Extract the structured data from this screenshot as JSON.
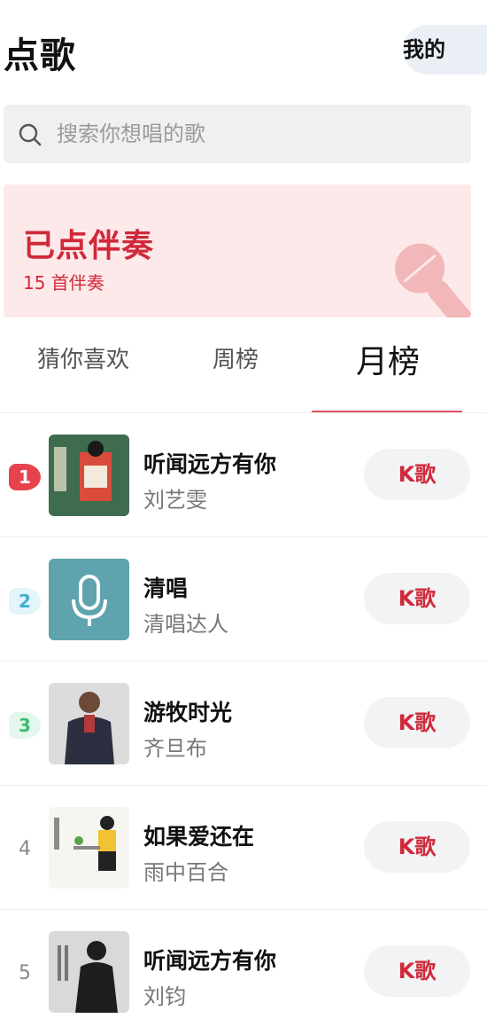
{
  "header": {
    "title": "点歌",
    "mine_label": "我的"
  },
  "search": {
    "placeholder": "搜索你想唱的歌",
    "value": ""
  },
  "banner": {
    "title": "已点伴奏",
    "subtitle": "15 首伴奏",
    "icon": "microphone-icon"
  },
  "tabs": [
    {
      "label": "猜你喜欢",
      "active": false
    },
    {
      "label": "周榜",
      "active": false
    },
    {
      "label": "月榜",
      "active": true
    }
  ],
  "songs": [
    {
      "rank": "1",
      "title": "听闻远方有你",
      "artist": "刘艺雯",
      "button": "K歌"
    },
    {
      "rank": "2",
      "title": "清唱",
      "artist": "清唱达人",
      "button": "K歌"
    },
    {
      "rank": "3",
      "title": "游牧时光",
      "artist": "齐旦布",
      "button": "K歌"
    },
    {
      "rank": "4",
      "title": "如果爱还在",
      "artist": "雨中百合",
      "button": "K歌"
    },
    {
      "rank": "5",
      "title": "听闻远方有你",
      "artist": "刘钧",
      "button": "K歌"
    }
  ],
  "colors": {
    "accent": "#d0293a",
    "banner_bg": "#fde9e9",
    "rank1": "#e6434f",
    "rank2": "#3fb0d0",
    "rank3": "#3cbc70"
  }
}
